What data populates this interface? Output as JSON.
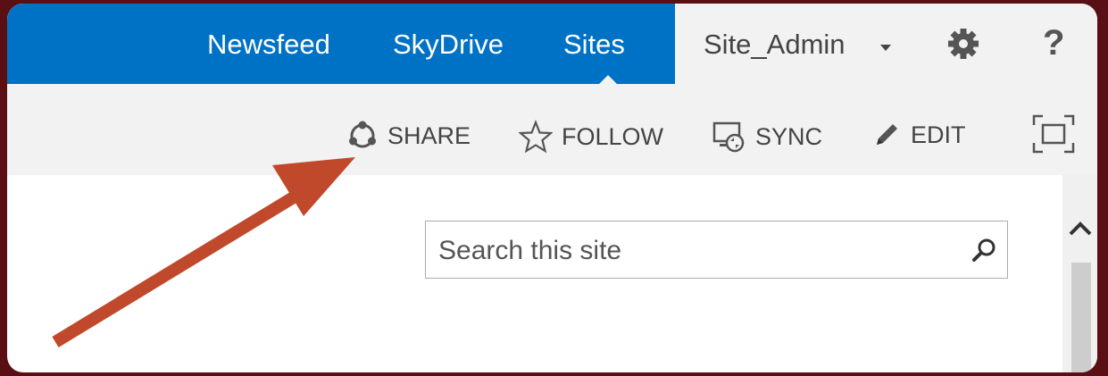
{
  "topnav": {
    "links": [
      "Newsfeed",
      "SkyDrive",
      "Sites"
    ],
    "user": "Site_Admin",
    "help": "?"
  },
  "actions": {
    "share": "SHARE",
    "follow": "FOLLOW",
    "sync": "SYNC",
    "edit": "EDIT"
  },
  "search": {
    "placeholder": "Search this site",
    "value": ""
  },
  "icons": {
    "settings": "gear-icon",
    "share": "share-icon",
    "follow": "star-icon",
    "sync": "sync-icon",
    "edit": "pencil-icon",
    "focus": "focus-icon",
    "search": "search-icon"
  },
  "colors": {
    "suite_bar": "#0072c6",
    "annotation_arrow": "#c0492c",
    "background": "#5a0f14"
  }
}
